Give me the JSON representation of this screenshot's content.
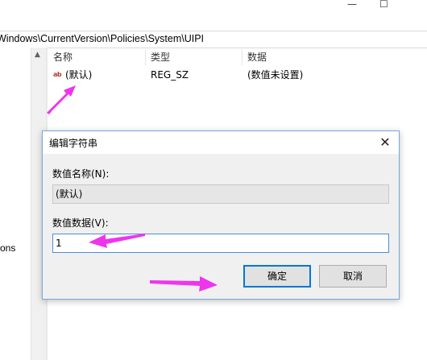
{
  "window": {
    "minimize_glyph": "—",
    "maximize_glyph": "☐"
  },
  "address_bar": {
    "path": "Windows\\CurrentVersion\\Policies\\System\\UIPI"
  },
  "tree": {
    "partial_item": "ons"
  },
  "list": {
    "columns": [
      "名称",
      "类型",
      "数据"
    ],
    "rows": [
      {
        "icon": "string-value-icon",
        "icon_text": "ab",
        "name": "(默认)",
        "type": "REG_SZ",
        "data": "(数值未设置)"
      }
    ]
  },
  "dialog": {
    "title": "编辑字符串",
    "close_glyph": "✕",
    "value_name_label": "数值名称(N):",
    "value_name": "(默认)",
    "value_data_label": "数值数据(V):",
    "value_data": "1",
    "ok_label": "确定",
    "cancel_label": "取消"
  },
  "colors": {
    "arrow": "#ee35ee",
    "dialog_border": "#7aa7d8",
    "focus": "#0078d7"
  }
}
